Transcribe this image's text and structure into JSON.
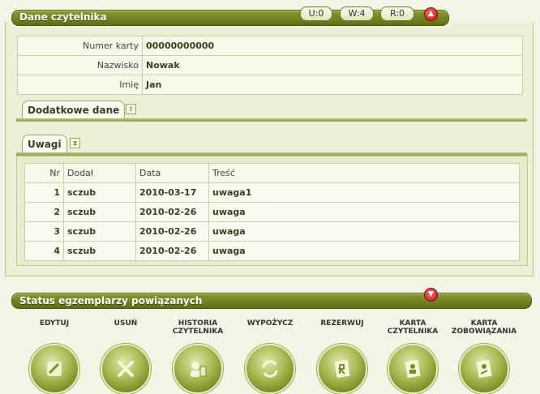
{
  "reader_section": {
    "title": "Dane czytelnika",
    "counters": [
      {
        "label": "U:0"
      },
      {
        "label": "W:4"
      },
      {
        "label": "R:0"
      }
    ],
    "fields": [
      {
        "label": "Numer karty",
        "value": "00000000000"
      },
      {
        "label": "Nazwisko",
        "value": "Nowak"
      },
      {
        "label": "Imię",
        "value": "Jan"
      }
    ]
  },
  "extra_tab": {
    "label": "Dodatkowe dane"
  },
  "notes_tab": {
    "label": "Uwagi",
    "columns": [
      "Nr",
      "Dodał",
      "Data",
      "Treść"
    ],
    "rows": [
      {
        "nr": "1",
        "added_by": "sczub",
        "date": "2010-03-17",
        "content": "uwaga1"
      },
      {
        "nr": "2",
        "added_by": "sczub",
        "date": "2010-02-26",
        "content": "uwaga"
      },
      {
        "nr": "3",
        "added_by": "sczub",
        "date": "2010-02-26",
        "content": "uwaga"
      },
      {
        "nr": "4",
        "added_by": "sczub",
        "date": "2010-02-26",
        "content": "uwaga"
      }
    ]
  },
  "status_section": {
    "title": "Status egzemplarzy powiązanych"
  },
  "actions": [
    {
      "label": "EDYTUJ",
      "icon": "edit-icon"
    },
    {
      "label": "USUŃ",
      "icon": "delete-icon"
    },
    {
      "label": "HISTORIA CZYTELNIKA",
      "icon": "history-icon"
    },
    {
      "label": "WYPOŻYCZ",
      "icon": "lend-icon"
    },
    {
      "label": "REZERWUJ",
      "icon": "reserve-icon"
    },
    {
      "label": "KARTA CZYTELNIKA",
      "icon": "reader-card-icon"
    },
    {
      "label": "KARTA ZOBOWIĄZANIA",
      "icon": "obligation-card-icon"
    }
  ],
  "colors": {
    "accent": "#6f7d26",
    "background": "#f3f5e6",
    "close": "#c01818"
  }
}
